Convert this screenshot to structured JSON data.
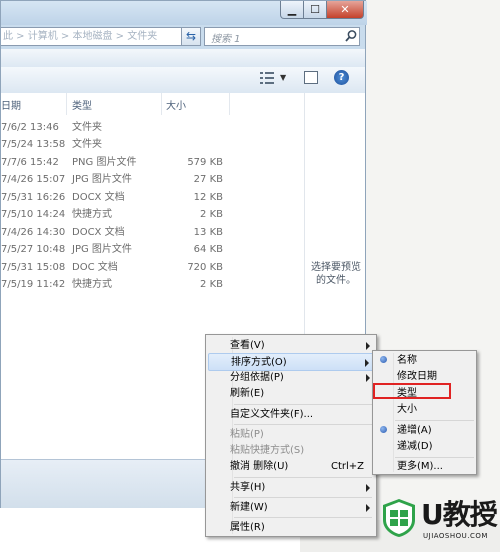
{
  "search": {
    "placeholder": "搜索 1"
  },
  "address": {
    "text": "此 > 计算机 > 本地磁盘 > 文件夹"
  },
  "columns": {
    "date": "日期",
    "type": "类型",
    "size": "大小"
  },
  "files": [
    {
      "date": "7/6/2 13:46",
      "type": "文件夹",
      "size": ""
    },
    {
      "date": "7/5/24 13:58",
      "type": "文件夹",
      "size": ""
    },
    {
      "date": "7/7/6 15:42",
      "type": "PNG 图片文件",
      "size": "579 KB"
    },
    {
      "date": "7/4/26 15:07",
      "type": "JPG 图片文件",
      "size": "27 KB"
    },
    {
      "date": "7/5/31 16:26",
      "type": "DOCX 文档",
      "size": "12 KB"
    },
    {
      "date": "7/5/10 14:24",
      "type": "快捷方式",
      "size": "2 KB"
    },
    {
      "date": "7/4/26 14:30",
      "type": "DOCX 文档",
      "size": "13 KB"
    },
    {
      "date": "7/5/27 10:48",
      "type": "JPG 图片文件",
      "size": "64 KB"
    },
    {
      "date": "7/5/31 15:08",
      "type": "DOC 文档",
      "size": "720 KB"
    },
    {
      "date": "7/5/19 11:42",
      "type": "快捷方式",
      "size": "2 KB"
    }
  ],
  "preview": {
    "message": "选择要预览的文件。"
  },
  "context_menu": {
    "view": "查看(V)",
    "sort_by": "排序方式(O)",
    "group_by": "分组依据(P)",
    "refresh": "刷新(E)",
    "customize_folder": "自定义文件夹(F)...",
    "paste": "粘贴(P)",
    "paste_shortcut": "粘贴快捷方式(S)",
    "undo_delete": "撤消 删除(U)",
    "undo_shortcut": "Ctrl+Z",
    "share": "共享(H)",
    "new": "新建(W)",
    "properties": "属性(R)"
  },
  "sort_submenu": {
    "name": "名称",
    "date_modified": "修改日期",
    "type": "类型",
    "size": "大小",
    "ascending": "递增(A)",
    "descending": "递减(D)",
    "more": "更多(M)..."
  },
  "watermark": {
    "brand": "U教授",
    "url": "UJIAOSHOU.COM"
  },
  "colors": {
    "accent": "#2a5bb0",
    "highlight_box": "#e02323",
    "logo_green": "#2fa34a"
  }
}
